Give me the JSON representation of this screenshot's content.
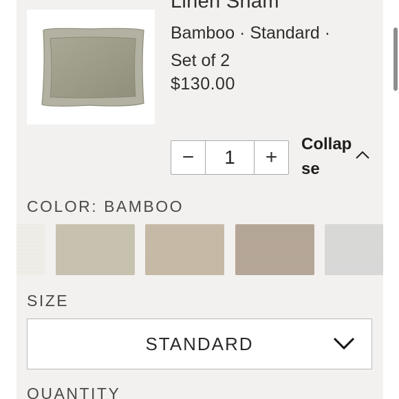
{
  "product": {
    "title": "Linen Sham",
    "variant": "Bamboo · Standard · Set of 2",
    "price": "$130.00"
  },
  "quantity_stepper": {
    "decrement_symbol": "−",
    "value": "1",
    "increment_symbol": "+"
  },
  "collapse_label": "Collapse",
  "color_section": {
    "label": "COLOR: BAMBOO",
    "swatches": [
      {
        "name": "white",
        "color": "#f2f0ea"
      },
      {
        "name": "bamboo",
        "color": "#c9c3b0",
        "selected": true
      },
      {
        "name": "sand",
        "color": "#c8bba7"
      },
      {
        "name": "taupe",
        "color": "#b6a797"
      },
      {
        "name": "light-gray",
        "color": "#dbdbda"
      }
    ]
  },
  "size_section": {
    "label": "SIZE",
    "selected": "STANDARD"
  },
  "quantity_section": {
    "label": "QUANTITY"
  },
  "colors": {
    "panel_bg": "#f3f1ef",
    "text": "#2e2e2e",
    "border": "#a9a9a9"
  }
}
